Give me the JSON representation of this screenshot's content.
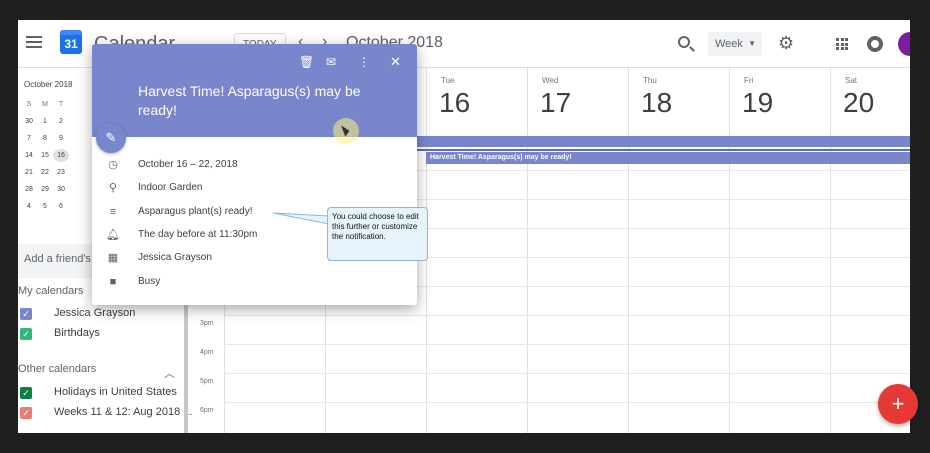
{
  "header": {
    "app_title": "Calendar",
    "logo_day": "31",
    "today_label": "TODAY",
    "month_label": "October 2018",
    "view_selected": "Week"
  },
  "sidebar": {
    "mini_month": "October 2018",
    "mini_dows": [
      "S",
      "M",
      "T"
    ],
    "mini_rows": [
      [
        "30",
        "1",
        "2"
      ],
      [
        "7",
        "8",
        "9"
      ],
      [
        "14",
        "15",
        "16"
      ],
      [
        "21",
        "22",
        "23"
      ],
      [
        "28",
        "29",
        "30"
      ],
      [
        "4",
        "5",
        "6"
      ]
    ],
    "add_friend_placeholder": "Add a friend's c",
    "my_calendars_title": "My calendars",
    "my_calendars": [
      {
        "name": "Jessica Grayson",
        "color": "#7986cb"
      },
      {
        "name": "Birthdays",
        "color": "#33b679"
      }
    ],
    "other_calendars_title": "Other calendars",
    "other_calendars": [
      {
        "name": "Holidays in United States",
        "color": "#0b8043"
      },
      {
        "name": "Weeks 11 & 12: Aug 2018 ...",
        "color": "#e67c73"
      }
    ]
  },
  "week": {
    "days": [
      {
        "name": "Tue",
        "num": "16"
      },
      {
        "name": "Wed",
        "num": "17"
      },
      {
        "name": "Thu",
        "num": "18"
      },
      {
        "name": "Fri",
        "num": "19"
      },
      {
        "name": "Sat",
        "num": "20"
      }
    ],
    "times": [
      "3pm",
      "4pm",
      "5pm",
      "6pm"
    ],
    "event_bar_text": "Harvest Time! Asparagus(s) may be ready!"
  },
  "popup": {
    "title": "Harvest Time! Asparagus(s) may be ready!",
    "date_range": "October 16 – 22, 2018",
    "location": "Indoor Garden",
    "description": "Asparagus plant(s) ready!",
    "notification": "The day before at 11:30pm",
    "calendar": "Jessica Grayson",
    "status": "Busy",
    "accent_color": "#7986cb"
  },
  "callout": {
    "text": "You could choose to edit this further or customize the notification."
  },
  "fab_label": "+"
}
